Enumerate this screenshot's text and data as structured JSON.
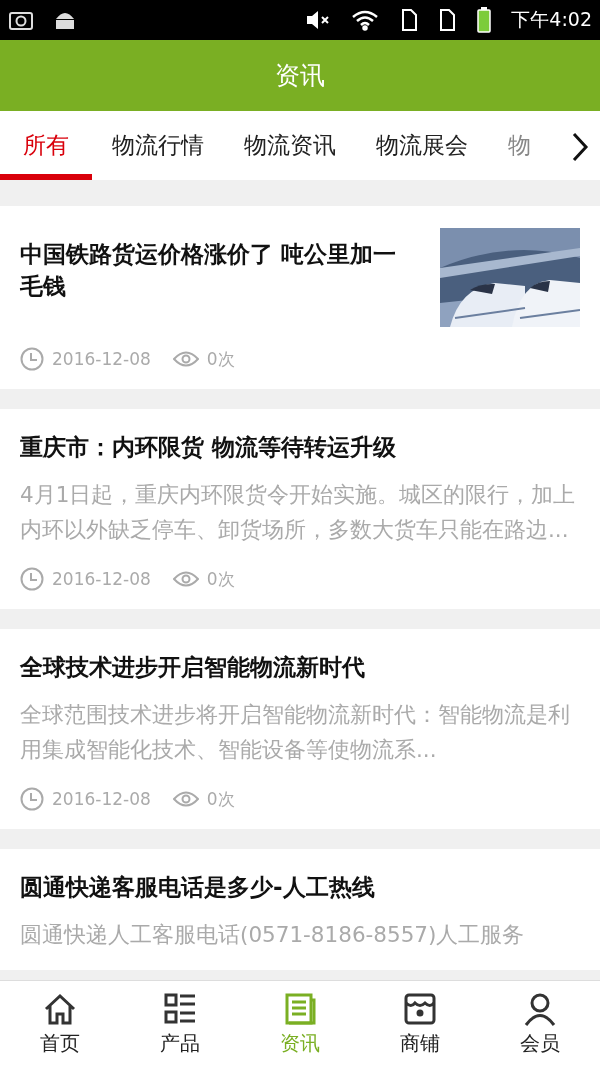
{
  "status_bar": {
    "time": "下午4:02"
  },
  "header": {
    "title": "资讯"
  },
  "tabs": [
    {
      "label": "所有",
      "selected": true
    },
    {
      "label": "物流行情",
      "selected": false
    },
    {
      "label": "物流资讯",
      "selected": false
    },
    {
      "label": "物流展会",
      "selected": false
    },
    {
      "label": "物",
      "selected": false
    }
  ],
  "articles": [
    {
      "title": "中国铁路货运价格涨价了 吨公里加一毛钱",
      "date": "2016-12-08",
      "views": "0次"
    },
    {
      "title": "重庆市：内环限货 物流等待转运升级",
      "summary": "4月1日起，重庆内环限货令开始实施。城区的限行，加上内环以外缺乏停车、卸货场所，多数大货车只能在路边...",
      "date": "2016-12-08",
      "views": "0次"
    },
    {
      "title": "全球技术进步开启智能物流新时代",
      "summary": "全球范围技术进步将开启智能物流新时代：智能物流是利用集成智能化技术、智能设备等使物流系...",
      "date": "2016-12-08",
      "views": "0次"
    },
    {
      "title": "圆通快递客服电话是多少-人工热线",
      "summary": "圆通快递人工客服电话(0571-8186-8557)人工服务"
    }
  ],
  "bottom_nav": [
    {
      "label": "首页",
      "kind": "home",
      "selected": false
    },
    {
      "label": "产品",
      "kind": "list",
      "selected": false
    },
    {
      "label": "资讯",
      "kind": "news",
      "selected": true
    },
    {
      "label": "商铺",
      "kind": "shop",
      "selected": false
    },
    {
      "label": "会员",
      "kind": "user",
      "selected": false
    }
  ]
}
